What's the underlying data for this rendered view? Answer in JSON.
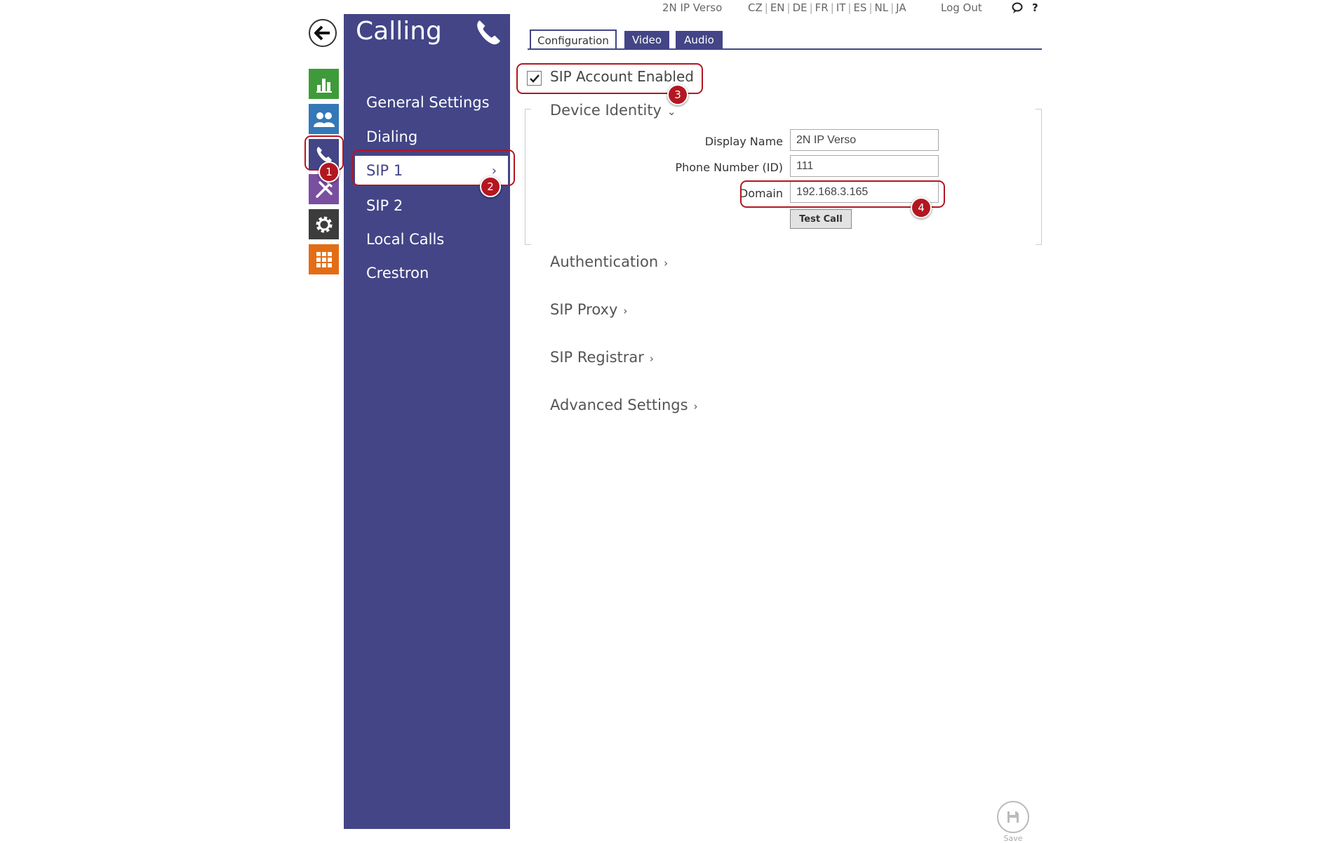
{
  "topbar": {
    "device_name": "2N IP Verso",
    "languages": [
      "CZ",
      "EN",
      "DE",
      "FR",
      "IT",
      "ES",
      "NL",
      "JA"
    ],
    "logout": "Log Out",
    "help": "?"
  },
  "rail": {
    "colors": {
      "status": "#3f9b3a",
      "directory": "#3578b7",
      "calling": "#434587",
      "hardware": "#7a4fa0",
      "system": "#3c3c3c",
      "services": "#e36d15"
    }
  },
  "menu": {
    "title": "Calling",
    "items": [
      {
        "label": "General Settings"
      },
      {
        "label": "Dialing"
      },
      {
        "label": "SIP 1",
        "active": true
      },
      {
        "label": "SIP 2"
      },
      {
        "label": "Local Calls"
      },
      {
        "label": "Crestron"
      }
    ]
  },
  "tabs": [
    {
      "label": "Configuration",
      "active": true
    },
    {
      "label": "Video"
    },
    {
      "label": "Audio"
    }
  ],
  "sip_enabled": {
    "label": "SIP Account Enabled",
    "checked": true
  },
  "device_identity": {
    "title": "Device Identity",
    "display_name_label": "Display Name",
    "display_name_value": "2N IP Verso",
    "phone_number_label": "Phone Number (ID)",
    "phone_number_value": "111",
    "domain_label": "Domain",
    "domain_value": "192.168.3.165",
    "test_call": "Test Call"
  },
  "sections": [
    {
      "label": "Authentication"
    },
    {
      "label": "SIP Proxy"
    },
    {
      "label": "SIP Registrar"
    },
    {
      "label": "Advanced Settings"
    }
  ],
  "annotations": [
    "1",
    "2",
    "3",
    "4"
  ],
  "save_label": "Save",
  "accent_color": "#434587",
  "callout_color": "#b31621"
}
